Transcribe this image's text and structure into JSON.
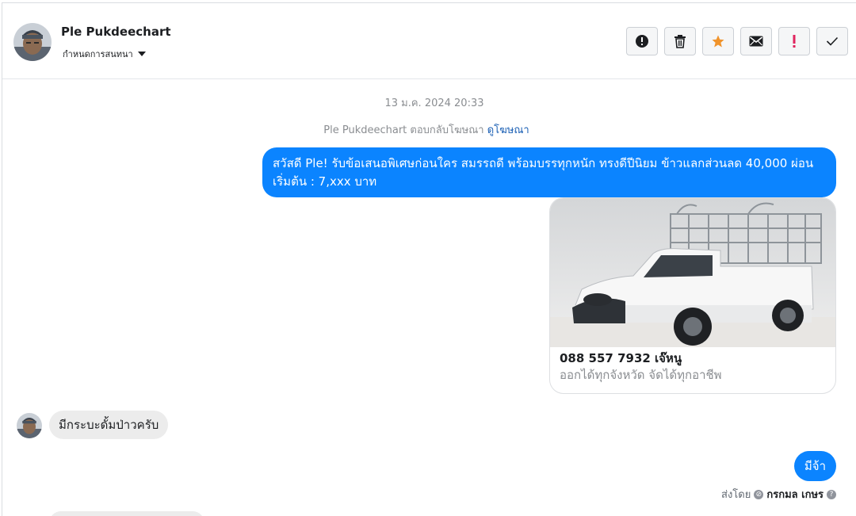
{
  "header": {
    "contact_name": "Ple Pukdeechart",
    "conversation_setting": "กำหนดการสนทนา"
  },
  "actions": [
    {
      "name": "spam-alert-button",
      "icon": "alert-circle-icon"
    },
    {
      "name": "delete-button",
      "icon": "trash-icon"
    },
    {
      "name": "star-button",
      "icon": "star-icon",
      "color": "#f0932b"
    },
    {
      "name": "mark-unread-button",
      "icon": "envelope-icon"
    },
    {
      "name": "follow-up-button",
      "icon": "exclamation-icon",
      "color": "#e0245e"
    },
    {
      "name": "mark-done-button",
      "icon": "check-icon"
    }
  ],
  "thread": {
    "timestamp": "13 ม.ค. 2024 20:33",
    "ad_reply_text": "Ple Pukdeechart ตอบกลับโฆษณา",
    "ad_reply_link": "ดูโฆษณา",
    "outgoing_message_1": "สวัสดี Ple! รับข้อเสนอพิเศษก่อนใคร สมรรถดี พร้อมบรรทุกหนัก ทรงดีปีนิยม ข้าวแลกส่วนลด 40,000 ผ่อนเริ่มต้น : 7,xxx บาท",
    "ad_card": {
      "title": "088 557 7932 เจ๊หนู",
      "subtitle": "ออกได้ทุกจังหวัด จัดได้ทุกอาชีพ"
    },
    "incoming_message_1": "มีกระบะดั้มป่าวครับ",
    "outgoing_message_2": "มีจ้า",
    "sent_by_label": "ส่งโดย",
    "sent_by_name": "กรกมล เกษร"
  },
  "colors": {
    "outgoing_bubble": "#0b84ff",
    "incoming_bubble": "#ececec",
    "link": "#1a5fb4"
  }
}
